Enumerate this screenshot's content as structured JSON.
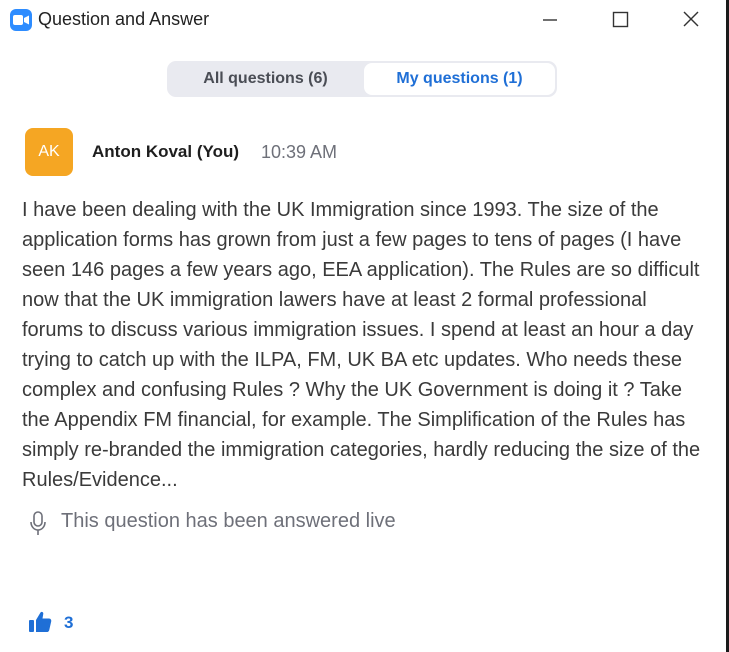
{
  "window": {
    "title": "Question and Answer",
    "icon": "camera-icon",
    "controls": [
      "minimize-icon",
      "maximize-icon",
      "close-icon"
    ]
  },
  "tabs": [
    {
      "label": "All questions (6)",
      "selected": false
    },
    {
      "label": "My questions (1)",
      "selected": true
    }
  ],
  "question": {
    "avatar_initials": "AK",
    "avatar_color": "#f5a623",
    "author": "Anton Koval (You)",
    "time": "10:39 AM",
    "text": "I have been dealing with the UK Immigration since 1993. The size of the application forms has grown from just a few pages to tens of pages (I have seen 146 pages a few years ago, EEA application). The Rules are so difficult now that the UK immigration lawers have at least 2 formal professional forums to discuss various immigration issues. I spend at least an hour a day trying to catch up with the ILPA, FM, UK BA etc updates. Who needs these complex and confusing Rules ? Why the UK Government is doing it ? Take the Appendix FM financial, for example. The Simplification of the Rules has simply re-branded the immigration categories, hardly reducing the size of the Rules/Evidence...",
    "status_icon": "microphone-icon",
    "status": "This question has been answered live",
    "likes": "3"
  },
  "colors": {
    "accent": "#1f6fd6",
    "app_icon": "#2d8cff",
    "muted_text": "#6e7079"
  }
}
